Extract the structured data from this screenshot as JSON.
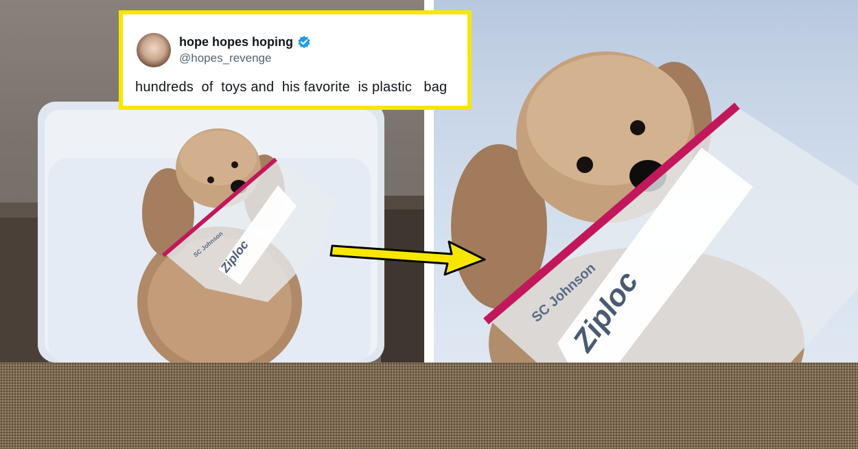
{
  "tweet": {
    "display_name": "hope hopes hoping",
    "handle": "@hopes_revenge",
    "text": "hundreds  of  toys and  his favorite  is plastic   bag",
    "verified": true
  },
  "left_photo": {
    "subject": "poodle-holding-ziploc-bag",
    "bag_brand": "Ziploc",
    "bag_small_print": "SC Johnson"
  },
  "right_photo": {
    "subject": "poodle-holding-ziploc-bag-closeup",
    "bag_brand": "Ziploc",
    "bag_small_print": "SC Johnson"
  },
  "arrow": {
    "color": "#f7e600",
    "icon": "right-arrow-icon"
  },
  "colors": {
    "card_border": "#f7e600",
    "verified": "#1d9bf0",
    "bottom_band": "#7d6a52"
  }
}
